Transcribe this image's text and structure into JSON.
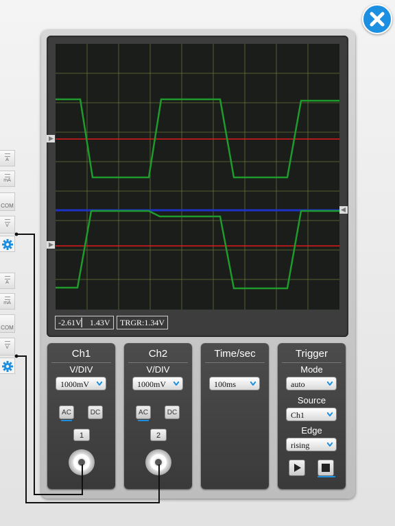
{
  "readout": {
    "range": "-2.61V▏ 1.43V",
    "trigger": "TRGR:1.34V"
  },
  "ch1": {
    "title": "Ch1",
    "vdiv_label": "V/DIV",
    "vdiv_value": "1000mV",
    "ac_label": "AC",
    "dc_label": "DC",
    "number": "1"
  },
  "ch2": {
    "title": "Ch2",
    "vdiv_label": "V/DIV",
    "vdiv_value": "1000mV",
    "ac_label": "AC",
    "dc_label": "DC",
    "number": "2"
  },
  "timebase": {
    "title": "Time/sec",
    "value": "100ms"
  },
  "trigger": {
    "title": "Trigger",
    "mode_label": "Mode",
    "mode_value": "auto",
    "source_label": "Source",
    "source_value": "Ch1",
    "edge_label": "Edge",
    "edge_value": "rising"
  },
  "probes": {
    "group1": [
      "A",
      "mA",
      "COM",
      "V"
    ],
    "group2": [
      "A",
      "mA",
      "COM",
      "V"
    ]
  },
  "colors": {
    "trace": "#1f9a2c",
    "reference": "#e01b1b",
    "trigger_level": "#1c32c8",
    "accent": "#1d8fe0"
  },
  "icons": [
    "close-icon",
    "gear-icon",
    "play-icon",
    "stop-icon",
    "chevron-down-icon",
    "marker-arrow-icon"
  ]
}
